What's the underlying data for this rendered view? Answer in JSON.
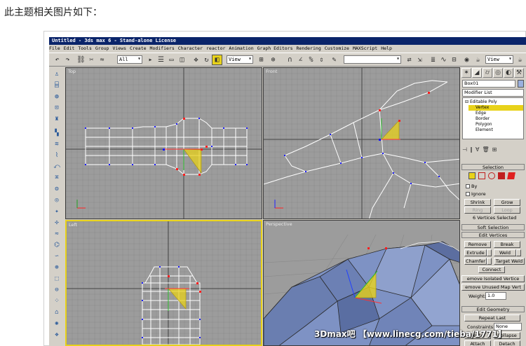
{
  "post": {
    "caption": "此主题相关图片如下："
  },
  "app": {
    "title": "Untitled - 3ds max 6 - Stand-alone License",
    "menu": [
      "File",
      "Edit",
      "Tools",
      "Group",
      "Views",
      "Create",
      "Modifiers",
      "Character",
      "reactor",
      "Animation",
      "Graph Editors",
      "Rendering",
      "Customize",
      "MAXScript",
      "Help"
    ]
  },
  "toolbar": {
    "selection_filter": "All",
    "ref_coord": "View",
    "named_sel": "",
    "view_right": "View"
  },
  "viewports": {
    "top": "Top",
    "front": "Front",
    "left": "Left",
    "perspective": "Perspective"
  },
  "command_panel": {
    "object_name": "Box01",
    "modifier_list": "Modifier List",
    "stack": [
      "Editable Poly",
      "Vertex",
      "Edge",
      "Border",
      "Polygon",
      "Element"
    ],
    "selection": {
      "title": "Selection",
      "by": "By",
      "ignore": "Ignore",
      "shrink": "Shrink",
      "grow": "Grow",
      "ring": "Ring",
      "loop": "Loop",
      "status": "6 Vertices Selected"
    },
    "soft_selection": "Soft Selection",
    "edit_vertices": {
      "title": "Edit Vertices",
      "remove": "Remove",
      "break": "Break",
      "extrude": "Extrude",
      "weld": "Weld",
      "chamfer": "Chamfer",
      "target_weld": "Target Weld",
      "connect": "Connect",
      "remove_isolated": "emove Isolated Vertice",
      "remove_unused": "emove Unused Map Vert",
      "weight_label": "Weight:",
      "weight_value": "1.0"
    },
    "edit_geometry": {
      "title": "Edit Geometry",
      "repeat_last": "Repeat Last",
      "constraints_label": "Constraints:",
      "constraints_value": "None",
      "create": "reate",
      "collapse": "Collapse",
      "attach": "Attach",
      "detach": "Detach"
    }
  },
  "watermark": "3Dmax吧 【www.linecg.com/tieba/1771】",
  "colors": {
    "viewport_bg": "#9c9c9c",
    "grid": "#8a8a8a",
    "wire": "#ffffff",
    "vertex": "#1a1aff",
    "selected_vertex": "#ff2020",
    "gizmo_fill": "#e8d21a",
    "active_border": "#e8d21a",
    "title_bar": "#0a246a",
    "ui_gray": "#d4d0c8",
    "mesh_blue": "#7e92c4"
  }
}
